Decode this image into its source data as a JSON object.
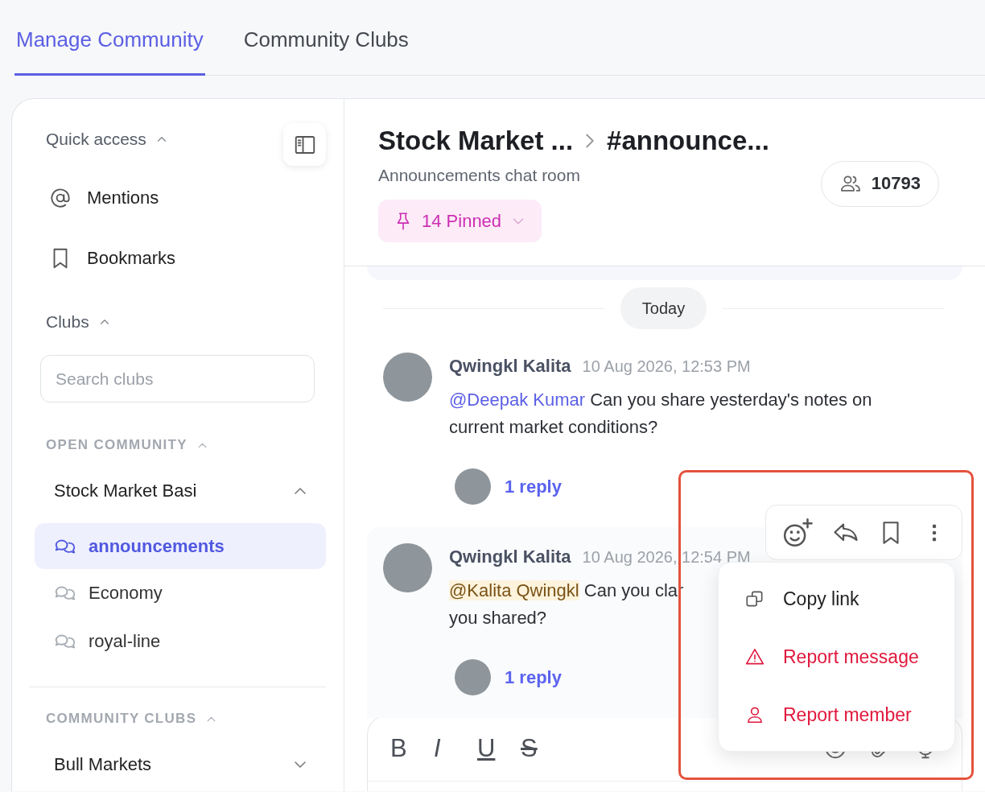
{
  "tabs": [
    {
      "label": "Manage Community",
      "selected": true
    },
    {
      "label": "Community Clubs",
      "selected": false
    }
  ],
  "sidebar": {
    "quick_access": {
      "label": "Quick access",
      "expanded": true,
      "items": [
        {
          "kind": "mentions",
          "label": "Mentions"
        },
        {
          "kind": "bookmarks",
          "label": "Bookmarks"
        }
      ]
    },
    "clubs": {
      "label": "Clubs",
      "expanded": true,
      "search": {
        "placeholder": "Search clubs"
      },
      "groups": [
        {
          "label": "OPEN COMMUNITY",
          "expanded": true,
          "clubs": [
            {
              "name": "Stock Market Basi",
              "expanded": true,
              "channels": [
                {
                  "name": "announcements",
                  "selected": true
                },
                {
                  "name": "Economy",
                  "selected": false
                },
                {
                  "name": "royal-line",
                  "selected": false
                }
              ]
            }
          ]
        },
        {
          "label": "COMMUNITY CLUBS",
          "expanded": true,
          "clubs": [
            {
              "name": "Bull Markets",
              "expanded": false
            }
          ]
        }
      ]
    }
  },
  "header": {
    "breadcrumb": [
      "Stock Market ...",
      "#announce..."
    ],
    "description": "Announcements chat room",
    "pinned": "14 Pinned",
    "members": "10793"
  },
  "date_divider": "Today",
  "messages": [
    {
      "author": "Qwingkl Kalita",
      "time": "10 Aug 2026, 12:53 PM",
      "mention": "@Deepak Kumar",
      "self_mention": false,
      "lines": [
        " Can you share yesterday's notes on",
        "current market conditions?"
      ],
      "replies": "1 reply",
      "hovered": false
    },
    {
      "author": "Qwingkl Kalita",
      "time": "10 Aug 2026, 12:54 PM",
      "mention": "@Kalita Qwingkl",
      "self_mention": true,
      "lines": [
        " Can you clar",
        "you shared?"
      ],
      "replies": "1 reply",
      "hovered": true,
      "menu": [
        {
          "kind": "copy",
          "label": "Copy link",
          "danger": false
        },
        {
          "kind": "report",
          "label": "Report message",
          "danger": true
        },
        {
          "kind": "member",
          "label": "Report member",
          "danger": true
        }
      ]
    }
  ],
  "composer": {
    "format_buttons": [
      {
        "kind": "bold",
        "label": "B"
      },
      {
        "kind": "italic",
        "label": "I"
      },
      {
        "kind": "underline",
        "label": "U"
      },
      {
        "kind": "strike",
        "label": "S"
      }
    ]
  },
  "highlight_frame": true
}
